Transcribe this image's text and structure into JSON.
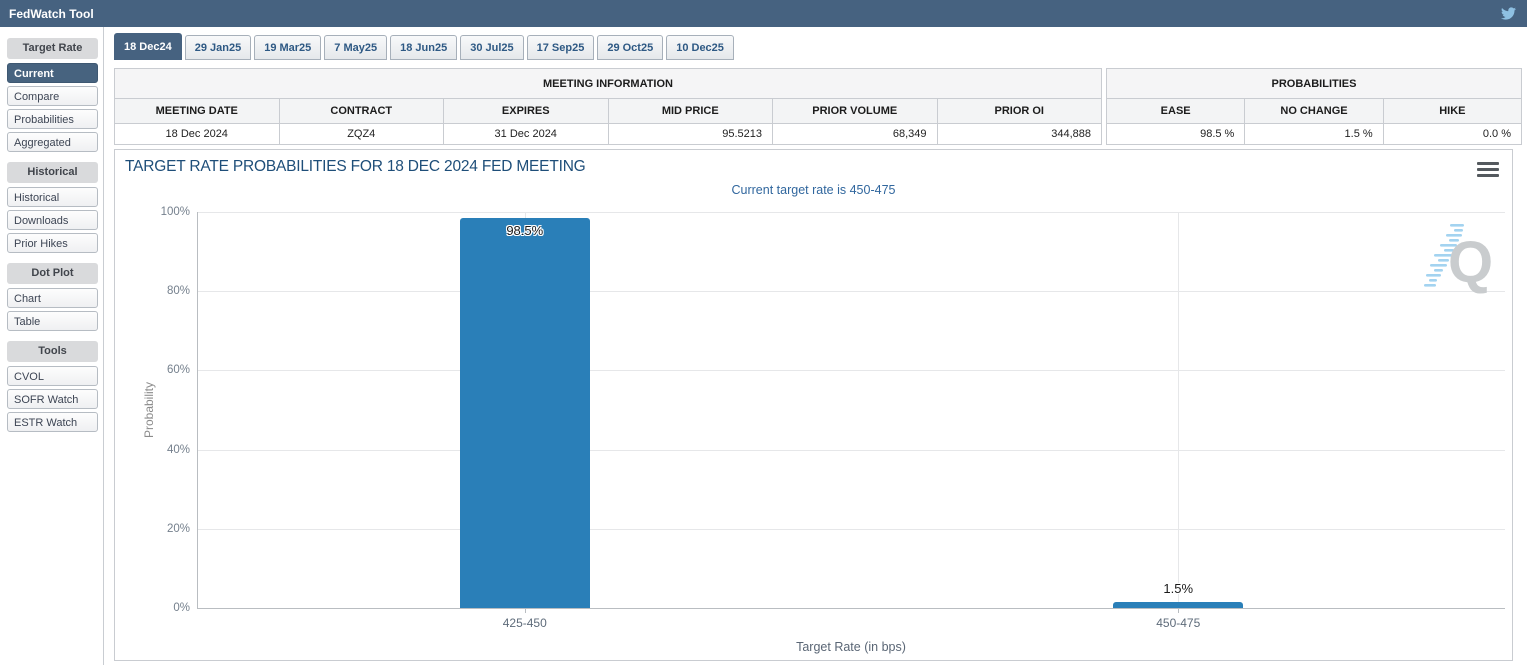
{
  "header": {
    "title": "FedWatch Tool",
    "icon": "twitter-bird"
  },
  "sidebar": {
    "sections": [
      {
        "header": "Target Rate",
        "items": [
          {
            "label": "Current",
            "active": true
          },
          {
            "label": "Compare",
            "active": false
          },
          {
            "label": "Probabilities",
            "active": false
          },
          {
            "label": "Aggregated",
            "active": false
          }
        ]
      },
      {
        "header": "Historical",
        "items": [
          {
            "label": "Historical",
            "active": false
          },
          {
            "label": "Downloads",
            "active": false
          },
          {
            "label": "Prior Hikes",
            "active": false
          }
        ]
      },
      {
        "header": "Dot Plot",
        "items": [
          {
            "label": "Chart",
            "active": false
          },
          {
            "label": "Table",
            "active": false
          }
        ]
      },
      {
        "header": "Tools",
        "items": [
          {
            "label": "CVOL",
            "active": false
          },
          {
            "label": "SOFR Watch",
            "active": false
          },
          {
            "label": "ESTR Watch",
            "active": false
          }
        ]
      }
    ]
  },
  "tabs": [
    {
      "label": "18 Dec24",
      "active": true
    },
    {
      "label": "29 Jan25",
      "active": false
    },
    {
      "label": "19 Mar25",
      "active": false
    },
    {
      "label": "7 May25",
      "active": false
    },
    {
      "label": "18 Jun25",
      "active": false
    },
    {
      "label": "30 Jul25",
      "active": false
    },
    {
      "label": "17 Sep25",
      "active": false
    },
    {
      "label": "29 Oct25",
      "active": false
    },
    {
      "label": "10 Dec25",
      "active": false
    }
  ],
  "meeting_info": {
    "caption": "MEETING INFORMATION",
    "columns": [
      "MEETING DATE",
      "CONTRACT",
      "EXPIRES",
      "MID PRICE",
      "PRIOR VOLUME",
      "PRIOR OI"
    ],
    "values": [
      "18 Dec 2024",
      "ZQZ4",
      "31 Dec 2024",
      "95.5213",
      "68,349",
      "344,888"
    ]
  },
  "probabilities": {
    "caption": "PROBABILITIES",
    "columns": [
      "EASE",
      "NO CHANGE",
      "HIKE"
    ],
    "values": [
      "98.5 %",
      "1.5 %",
      "0.0 %"
    ]
  },
  "chart_data": {
    "type": "bar",
    "title": "TARGET RATE PROBABILITIES FOR 18 DEC 2024 FED MEETING",
    "subtitle": "Current target rate is 450-475",
    "categories": [
      "425-450",
      "450-475"
    ],
    "values": [
      98.5,
      1.5
    ],
    "value_labels": [
      "98.5%",
      "1.5%"
    ],
    "xlabel": "Target Rate (in bps)",
    "ylabel": "Probability",
    "ylim": [
      0,
      100
    ],
    "yticks": [
      {
        "v": 0,
        "label": "0%"
      },
      {
        "v": 20,
        "label": "20%"
      },
      {
        "v": 40,
        "label": "40%"
      },
      {
        "v": 60,
        "label": "60%"
      },
      {
        "v": 80,
        "label": "80%"
      },
      {
        "v": 100,
        "label": "100%"
      }
    ],
    "bar_color": "#2a7fb8",
    "grid": true,
    "legend": "none",
    "watermark_icon": "quikstrike-q-logo",
    "menu_icon": "hamburger-menu"
  }
}
